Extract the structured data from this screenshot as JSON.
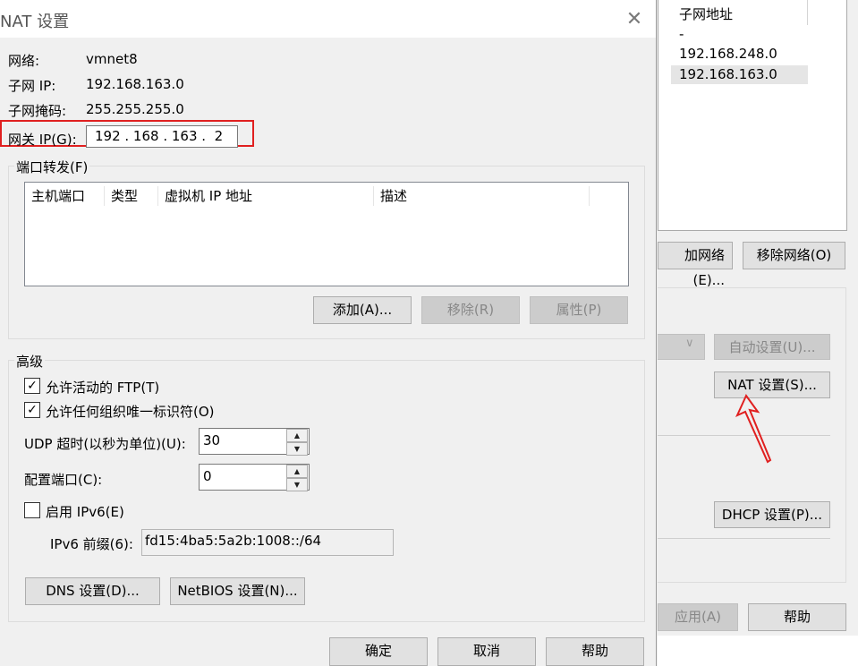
{
  "background": {
    "list_header": "子网地址",
    "subnets": [
      "-",
      "192.168.248.0",
      "192.168.163.0"
    ],
    "add_network_label": "加网络(E)...",
    "remove_network_label": "移除网络(O)",
    "auto_settings_label": "自动设置(U)...",
    "nat_settings_label": "NAT 设置(S)...",
    "dhcp_settings_label": "DHCP 设置(P)...",
    "apply_label": "应用(A)",
    "help_label": "帮助"
  },
  "dialog": {
    "title": "NAT 设置",
    "network_label": "网络:",
    "network_value": "vmnet8",
    "subnet_ip_label": "子网 IP:",
    "subnet_ip_value": "192.168.163.0",
    "subnet_mask_label": "子网掩码:",
    "subnet_mask_value": "255.255.255.0",
    "gateway_label": "网关 IP(G):",
    "gateway_value": "192 . 168 . 163 .  2",
    "port_forward": {
      "title": "端口转发(F)",
      "columns": [
        "主机端口",
        "类型",
        "虚拟机 IP 地址",
        "描述"
      ],
      "add_label": "添加(A)...",
      "remove_label": "移除(R)",
      "properties_label": "属性(P)"
    },
    "advanced": {
      "title": "高级",
      "allow_ftp_label": "允许活动的 FTP(T)",
      "allow_ftp_checked": true,
      "allow_uuid_label": "允许任何组织唯一标识符(O)",
      "allow_uuid_checked": true,
      "udp_timeout_label": "UDP 超时(以秒为单位)(U):",
      "udp_timeout_value": "30",
      "config_port_label": "配置端口(C):",
      "config_port_value": "0",
      "enable_ipv6_label": "启用 IPv6(E)",
      "enable_ipv6_checked": false,
      "ipv6_prefix_label": "IPv6 前缀(6):",
      "ipv6_prefix_value": "fd15:4ba5:5a2b:1008::/64",
      "dns_label": "DNS 设置(D)...",
      "netbios_label": "NetBIOS 设置(N)..."
    },
    "ok_label": "确定",
    "cancel_label": "取消",
    "help_label": "帮助"
  },
  "colors": {
    "highlight_red": "#e02020"
  }
}
